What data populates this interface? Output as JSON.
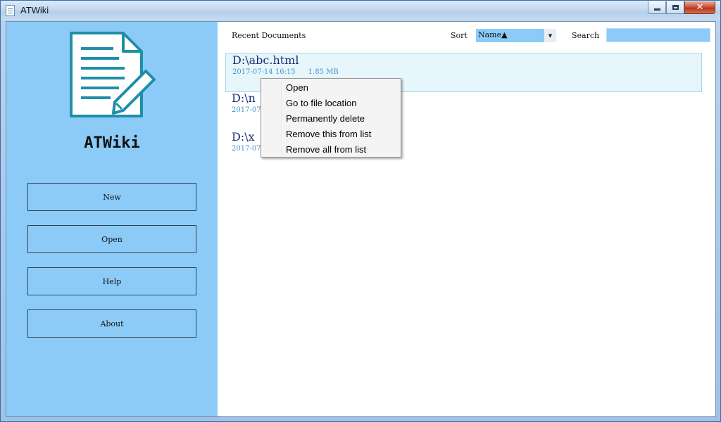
{
  "window": {
    "title": "ATWiki",
    "controls": {
      "minimize": "minimize",
      "maximize": "maximize",
      "close": "✕"
    }
  },
  "sidebar": {
    "app_name": "ATWiki",
    "logo_icon": "document-edit-icon",
    "buttons": [
      {
        "label": "New"
      },
      {
        "label": "Open"
      },
      {
        "label": "Help"
      },
      {
        "label": "About"
      }
    ]
  },
  "main": {
    "heading": "Recent Documents",
    "sort": {
      "label": "Sort",
      "value": "Name▲"
    },
    "search": {
      "label": "Search",
      "value": "",
      "placeholder": ""
    },
    "documents": [
      {
        "path": "D:\\abc.html",
        "date": "2017-07-14 16:15",
        "size": "1.85 MB",
        "selected": true
      },
      {
        "path": "D:\\n",
        "date": "2017-07",
        "size": ""
      },
      {
        "path": "D:\\x",
        "date": "2017-07",
        "size": ""
      }
    ]
  },
  "context_menu": {
    "items": [
      {
        "label": "Open"
      },
      {
        "label": "Go to file location"
      },
      {
        "label": "Permanently delete"
      },
      {
        "label": "Remove this from list"
      },
      {
        "label": "Remove all from list"
      }
    ]
  },
  "colors": {
    "sidebar_bg": "#8ccbf8",
    "doc_path": "#1b2e73",
    "doc_meta": "#4f92c9",
    "selected_bg": "#e6f6fb"
  }
}
